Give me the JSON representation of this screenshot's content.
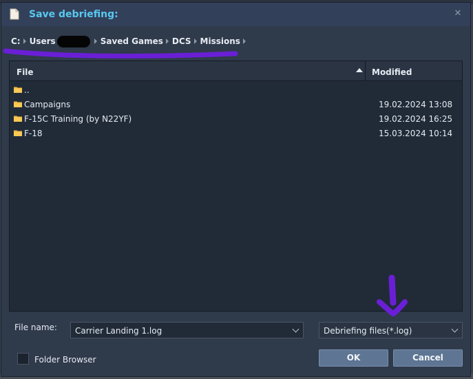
{
  "dialog": {
    "title": "Save debriefing:",
    "close_glyph": "✕"
  },
  "breadcrumb": {
    "items": [
      "C:",
      "Users",
      "Saved Games",
      "DCS",
      "Missions"
    ]
  },
  "filelist": {
    "columns": {
      "file": "File",
      "modified": "Modified"
    },
    "rows": [
      {
        "name": "..",
        "modified": ""
      },
      {
        "name": "Campaigns",
        "modified": "19.02.2024 13:08"
      },
      {
        "name": "F-15C Training (by N22YF)",
        "modified": "19.02.2024 16:25"
      },
      {
        "name": "F-18",
        "modified": "15.03.2024 10:14"
      }
    ]
  },
  "form": {
    "filename_label": "File name:",
    "filename_value": "Carrier Landing 1.log",
    "filetype_value": "Debriefing files(*.log)",
    "folder_browser_label": "Folder Browser",
    "folder_browser_checked": false
  },
  "buttons": {
    "ok": "OK",
    "cancel": "Cancel"
  },
  "colors": {
    "title": "#58c8f0",
    "folder": "#f2b53a",
    "annotation": "#6a1fd6",
    "button": "#5e7593"
  },
  "icons": [
    "document-icon",
    "close-icon",
    "folder-icon",
    "sort-ascending-icon",
    "chevron-down-icon"
  ]
}
